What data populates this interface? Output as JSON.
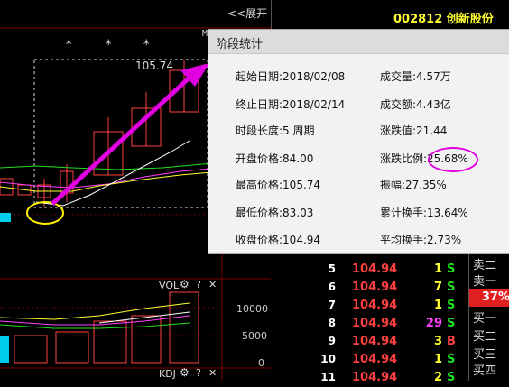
{
  "toolbar": {
    "expand_label": "<<展开"
  },
  "stock": {
    "code_name": "002812 创新股份"
  },
  "chart": {
    "stars": [
      "*",
      "*",
      "*"
    ],
    "max_price_label": "105.74",
    "corner_mark": "M"
  },
  "popup": {
    "title": "阶段统计",
    "stats_left": [
      {
        "label": "起始日期:",
        "value": "2018/02/08"
      },
      {
        "label": "终止日期:",
        "value": "2018/02/14"
      },
      {
        "label": "时段长度:",
        "value": "5 周期"
      },
      {
        "label": "开盘价格:",
        "value": "84.00"
      },
      {
        "label": "最高价格:",
        "value": "105.74"
      },
      {
        "label": "最低价格:",
        "value": "83.03"
      },
      {
        "label": "收盘价格:",
        "value": "104.94"
      }
    ],
    "stats_right": [
      {
        "label": "成交量:",
        "value": "4.57万"
      },
      {
        "label": "成交额:",
        "value": "4.43亿"
      },
      {
        "label": "涨跌值:",
        "value": "21.44"
      },
      {
        "label": "涨跌比例:",
        "value": "25.68%"
      },
      {
        "label": "振幅:",
        "value": "27.35%"
      },
      {
        "label": "累计换手:",
        "value": "13.64%"
      },
      {
        "label": "平均换手:",
        "value": "2.73%"
      }
    ]
  },
  "volume_panel": {
    "label": "VOL",
    "gear": "⚙",
    "help": "?",
    "close": "✕",
    "axis": [
      "10000",
      "5000",
      "0"
    ]
  },
  "kdj_panel": {
    "label": "KDJ",
    "gear": "⚙",
    "help": "?",
    "close": "✕"
  },
  "trades": [
    {
      "idx": "5",
      "price": "104.94",
      "vol": "1",
      "side": "S"
    },
    {
      "idx": "6",
      "price": "104.94",
      "vol": "7",
      "side": "S"
    },
    {
      "idx": "7",
      "price": "104.94",
      "vol": "1",
      "side": "S"
    },
    {
      "idx": "8",
      "price": "104.94",
      "vol": "29",
      "side": "S"
    },
    {
      "idx": "9",
      "price": "104.94",
      "vol": "3",
      "side": "B"
    },
    {
      "idx": "10",
      "price": "104.94",
      "vol": "1",
      "side": "S"
    },
    {
      "idx": "11",
      "price": "104.94",
      "vol": "2",
      "side": "S"
    }
  ],
  "order_book_labels": [
    "卖二",
    "卖一",
    "买一",
    "买二",
    "买三",
    "买四"
  ],
  "change_badge": "37%",
  "colors": {
    "up": "#ff4040",
    "accent": "#e000e0",
    "sell_side": "#22dd22",
    "buy_side": "#ff4040",
    "highlight_big_volume": "#ff40ff"
  }
}
